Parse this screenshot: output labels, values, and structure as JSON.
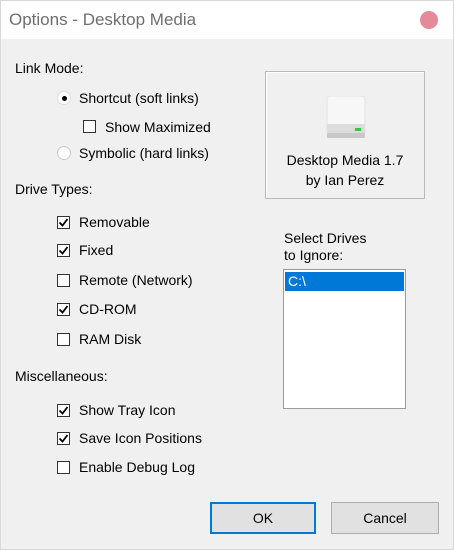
{
  "window": {
    "title": "Options - Desktop Media"
  },
  "link_mode": {
    "heading": "Link Mode:",
    "shortcut_label": "Shortcut (soft links)",
    "shortcut_selected": true,
    "show_maximized_label": "Show Maximized",
    "show_maximized_checked": false,
    "symbolic_label": "Symbolic (hard links)",
    "symbolic_selected": false
  },
  "drive_types": {
    "heading": "Drive Types:",
    "items": [
      {
        "label": "Removable",
        "checked": true
      },
      {
        "label": "Fixed",
        "checked": true
      },
      {
        "label": "Remote (Network)",
        "checked": false
      },
      {
        "label": "CD-ROM",
        "checked": true
      },
      {
        "label": "RAM Disk",
        "checked": false
      }
    ]
  },
  "misc": {
    "heading": "Miscellaneous:",
    "items": [
      {
        "label": "Show Tray Icon",
        "checked": true
      },
      {
        "label": "Save Icon Positions",
        "checked": true
      },
      {
        "label": "Enable Debug Log",
        "checked": false
      }
    ]
  },
  "about": {
    "icon": "drive-icon",
    "line1": "Desktop Media 1.7",
    "line2": "by Ian Perez"
  },
  "ignore_drives": {
    "label_line1": "Select Drives",
    "label_line2": "to Ignore:",
    "items": [
      "C:\\"
    ],
    "selected": "C:\\"
  },
  "buttons": {
    "ok": "OK",
    "cancel": "Cancel"
  }
}
